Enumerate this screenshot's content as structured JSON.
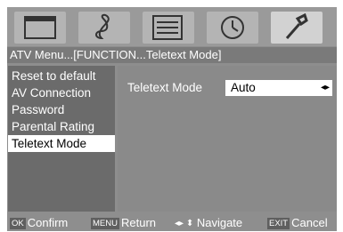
{
  "icons": [
    {
      "name": "picture-icon",
      "active": false
    },
    {
      "name": "sound-icon",
      "active": false
    },
    {
      "name": "channel-icon",
      "active": false
    },
    {
      "name": "time-icon",
      "active": false
    },
    {
      "name": "function-icon",
      "active": true
    }
  ],
  "breadcrumb": "ATV Menu...[FUNCTION...Teletext Mode]",
  "sidebar": {
    "items": [
      {
        "label": "Reset to default",
        "selected": false
      },
      {
        "label": "AV Connection",
        "selected": false
      },
      {
        "label": "Password",
        "selected": false
      },
      {
        "label": "Parental Rating",
        "selected": false
      },
      {
        "label": "Teletext Mode",
        "selected": true
      }
    ]
  },
  "setting": {
    "label": "Teletext Mode",
    "value": "Auto",
    "arrows": "◂▸"
  },
  "footer": {
    "confirm_key": "OK",
    "confirm_label": "Confirm",
    "return_key": "MENU",
    "return_label": "Return",
    "navigate_arrows": "◂▸ ⬍",
    "navigate_label": "Navigate",
    "cancel_key": "EXIT",
    "cancel_label": "Cancel"
  },
  "colors": {
    "background": "#8e8e8e",
    "selection": "#ffffff",
    "sidebar": "#6b6b6b"
  }
}
